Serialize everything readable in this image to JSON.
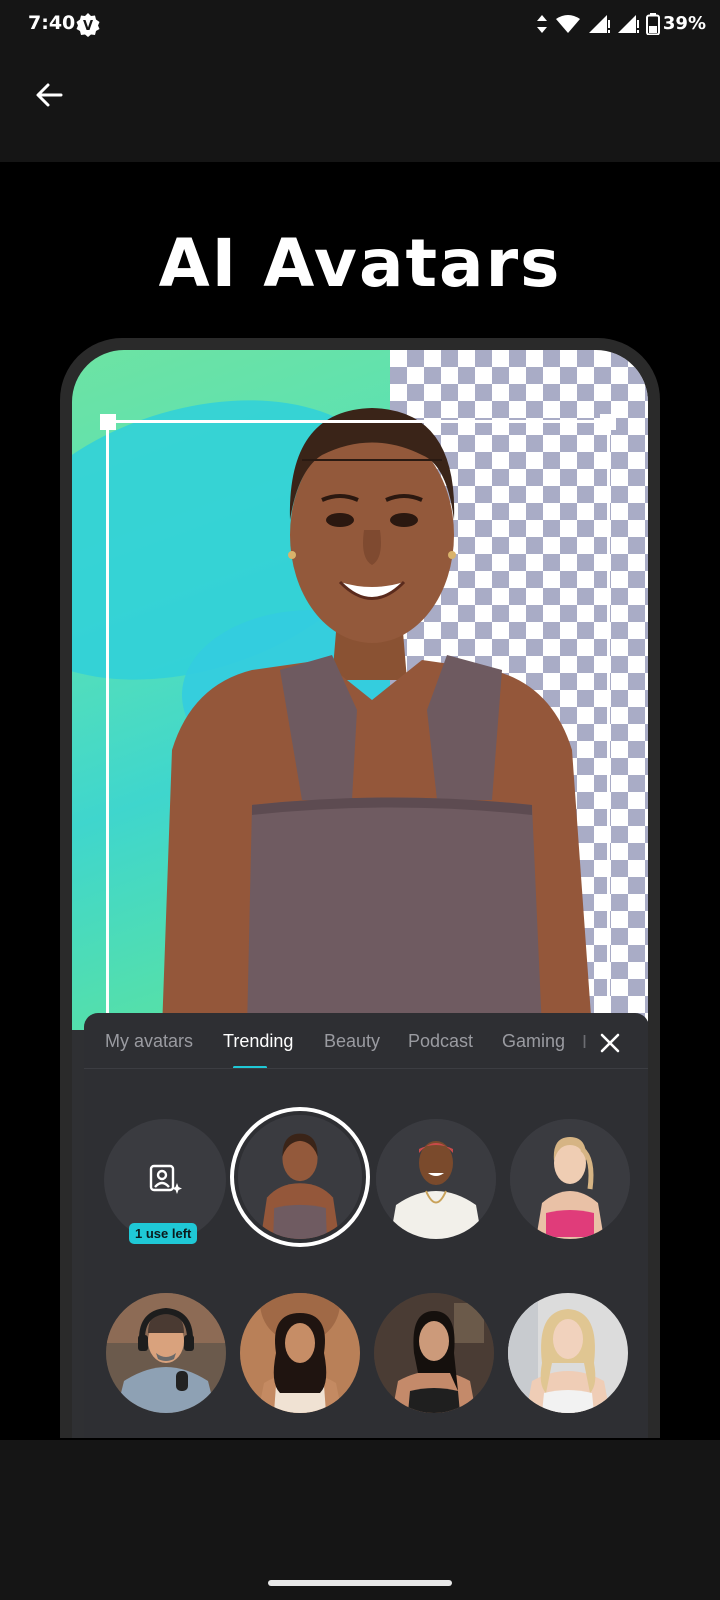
{
  "status_bar": {
    "time": "7:40",
    "battery": "39%",
    "icons": [
      "data-arrows-icon",
      "wifi-icon",
      "signal-icon",
      "signal-icon",
      "battery-icon"
    ]
  },
  "app_bar": {
    "back_icon": "arrow-left-icon"
  },
  "title": "AI Avatars",
  "sheet": {
    "tabs": [
      {
        "label": "My avatars"
      },
      {
        "label": "Trending",
        "active": true
      },
      {
        "label": "Beauty"
      },
      {
        "label": "Podcast"
      },
      {
        "label": "Gaming"
      }
    ],
    "create_badge": "1 use left",
    "accent": "#1fc8d6"
  },
  "colors": {
    "background": "#000000",
    "bar": "#151515",
    "sheet": "#2e2f33"
  }
}
